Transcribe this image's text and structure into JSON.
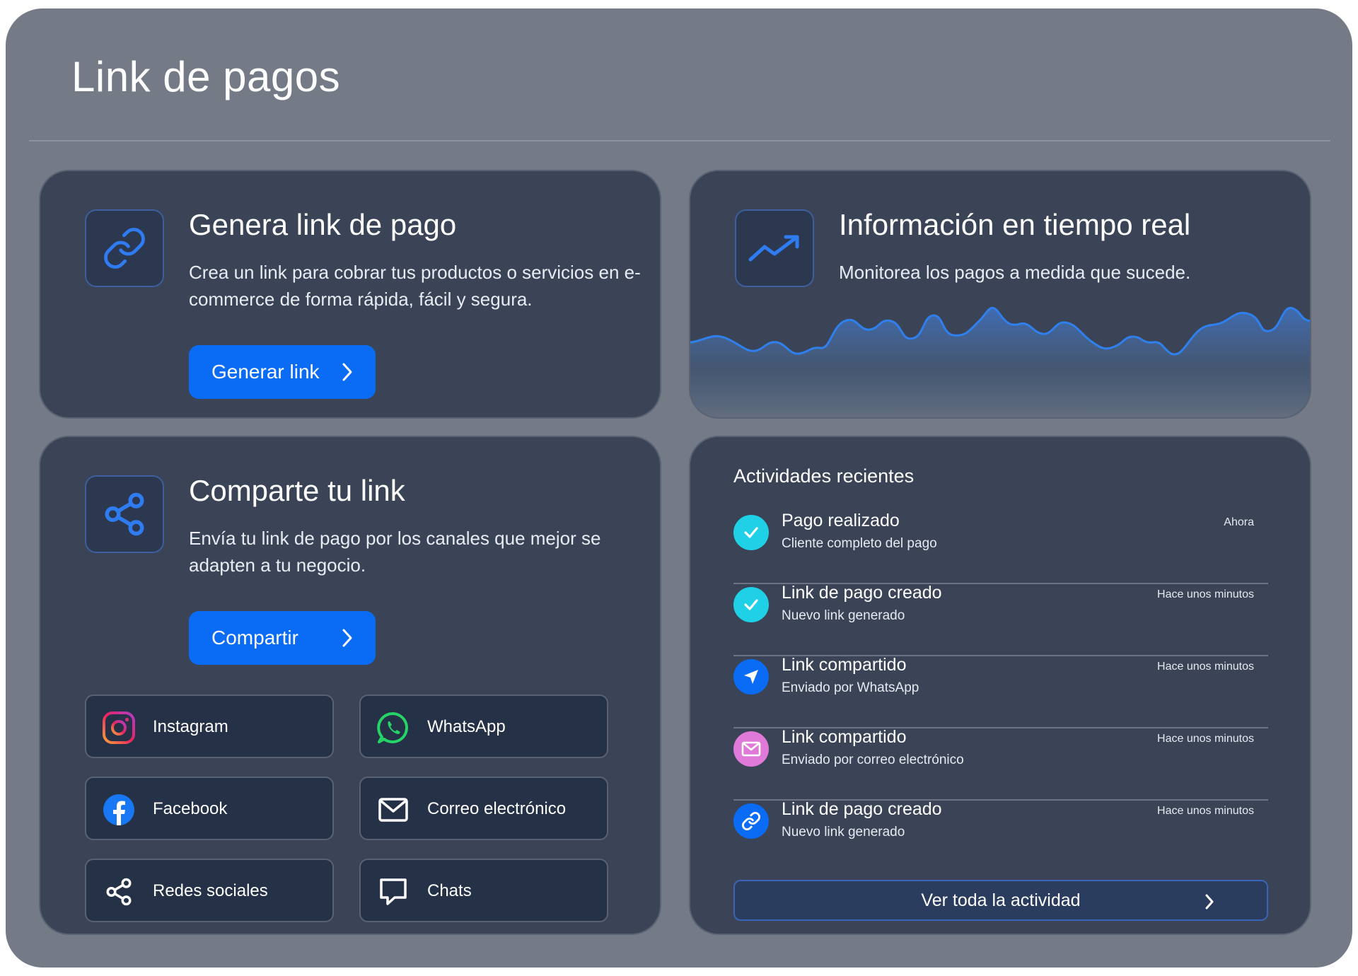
{
  "header": {
    "title": "Link de pagos"
  },
  "genera": {
    "title": "Genera link de pago",
    "description": "Crea un link para cobrar tus productos o servicios en e-commerce de forma rápida, fácil y segura.",
    "button_label": "Generar link",
    "icon": "link-icon"
  },
  "info": {
    "title": "Información en tiempo real",
    "description": "Monitorea los pagos a medida que sucede.",
    "icon": "trend-up-icon"
  },
  "comparte": {
    "title": "Comparte tu link",
    "description": "Envía tu link de pago por los canales que mejor se adapten a tu negocio.",
    "button_label": "Compartir",
    "icon": "share-icon",
    "channels": [
      {
        "label": "Instagram",
        "icon": "instagram-icon"
      },
      {
        "label": "WhatsApp",
        "icon": "whatsapp-icon"
      },
      {
        "label": "Facebook",
        "icon": "facebook-icon"
      },
      {
        "label": "Correo electrónico",
        "icon": "mail-icon"
      },
      {
        "label": "Redes sociales",
        "icon": "share-icon"
      },
      {
        "label": "Chats",
        "icon": "chat-icon"
      }
    ]
  },
  "activity": {
    "title": "Actividades recientes",
    "items": [
      {
        "title": "Pago realizado",
        "subtitle": "Cliente completo del pago",
        "time": "Ahora",
        "icon": "check-icon"
      },
      {
        "title": "Link de pago creado",
        "subtitle": "Nuevo link generado",
        "time": "Hace unos minutos",
        "icon": "check-icon"
      },
      {
        "title": "Link compartido",
        "subtitle": "Enviado por WhatsApp",
        "time": "Hace unos minutos",
        "icon": "send-icon"
      },
      {
        "title": "Link compartido",
        "subtitle": "Enviado por correo electrónico",
        "time": "Hace unos minutos",
        "icon": "mail-icon"
      },
      {
        "title": "Link de pago creado",
        "subtitle": "Nuevo link generado",
        "time": "Hace unos minutos",
        "icon": "link-icon"
      }
    ],
    "view_all_label": "Ver toda la actividad"
  },
  "colors": {
    "accent": "#0a6cf5",
    "check": "#1fd0e6",
    "mail_pink": "#e07ad8",
    "card": "#3a4456",
    "frame": "#747b87"
  }
}
